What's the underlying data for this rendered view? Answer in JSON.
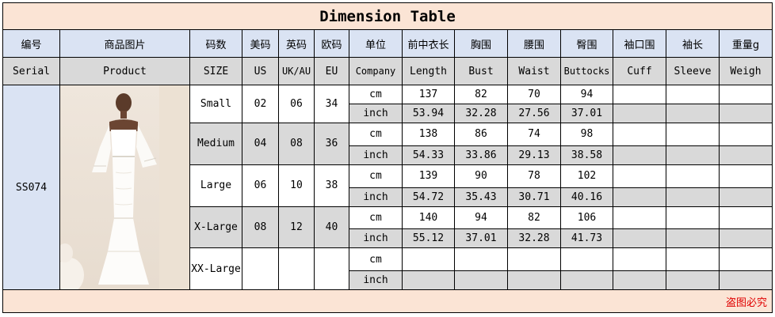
{
  "title": "Dimension Table",
  "headers_zh": [
    "编号",
    "商品图片",
    "码数",
    "美码",
    "英码",
    "欧码",
    "单位",
    "前中衣长",
    "胸围",
    "腰围",
    "臀围",
    "袖口围",
    "袖长",
    "重量g"
  ],
  "headers_en": [
    "Serial",
    "Product",
    "SIZE",
    "US",
    "UK/AU",
    "EU",
    "Company",
    "Length",
    "Bust",
    "Waist",
    "Buttocks",
    "Cuff",
    "Sleeve",
    "Weigh"
  ],
  "serial": "SS074",
  "product_image": "white off-shoulder lace mermaid maxi dress photo",
  "sizes": [
    {
      "name": "Small",
      "us": "02",
      "uk": "06",
      "eu": "34",
      "cm": {
        "unit": "cm",
        "length": "137",
        "bust": "82",
        "waist": "70",
        "buttocks": "94"
      },
      "inch": {
        "unit": "inch",
        "length": "53.94",
        "bust": "32.28",
        "waist": "27.56",
        "buttocks": "37.01"
      }
    },
    {
      "name": "Medium",
      "us": "04",
      "uk": "08",
      "eu": "36",
      "cm": {
        "unit": "cm",
        "length": "138",
        "bust": "86",
        "waist": "74",
        "buttocks": "98"
      },
      "inch": {
        "unit": "inch",
        "length": "54.33",
        "bust": "33.86",
        "waist": "29.13",
        "buttocks": "38.58"
      }
    },
    {
      "name": "Large",
      "us": "06",
      "uk": "10",
      "eu": "38",
      "cm": {
        "unit": "cm",
        "length": "139",
        "bust": "90",
        "waist": "78",
        "buttocks": "102"
      },
      "inch": {
        "unit": "inch",
        "length": "54.72",
        "bust": "35.43",
        "waist": "30.71",
        "buttocks": "40.16"
      }
    },
    {
      "name": "X-Large",
      "us": "08",
      "uk": "12",
      "eu": "40",
      "cm": {
        "unit": "cm",
        "length": "140",
        "bust": "94",
        "waist": "82",
        "buttocks": "106"
      },
      "inch": {
        "unit": "inch",
        "length": "55.12",
        "bust": "37.01",
        "waist": "32.28",
        "buttocks": "41.73"
      }
    },
    {
      "name": "XX-Large",
      "us": "",
      "uk": "",
      "eu": "",
      "cm": {
        "unit": "cm",
        "length": "",
        "bust": "",
        "waist": "",
        "buttocks": ""
      },
      "inch": {
        "unit": "inch",
        "length": "",
        "bust": "",
        "waist": "",
        "buttocks": ""
      }
    }
  ],
  "footer_note": "盗图必究"
}
